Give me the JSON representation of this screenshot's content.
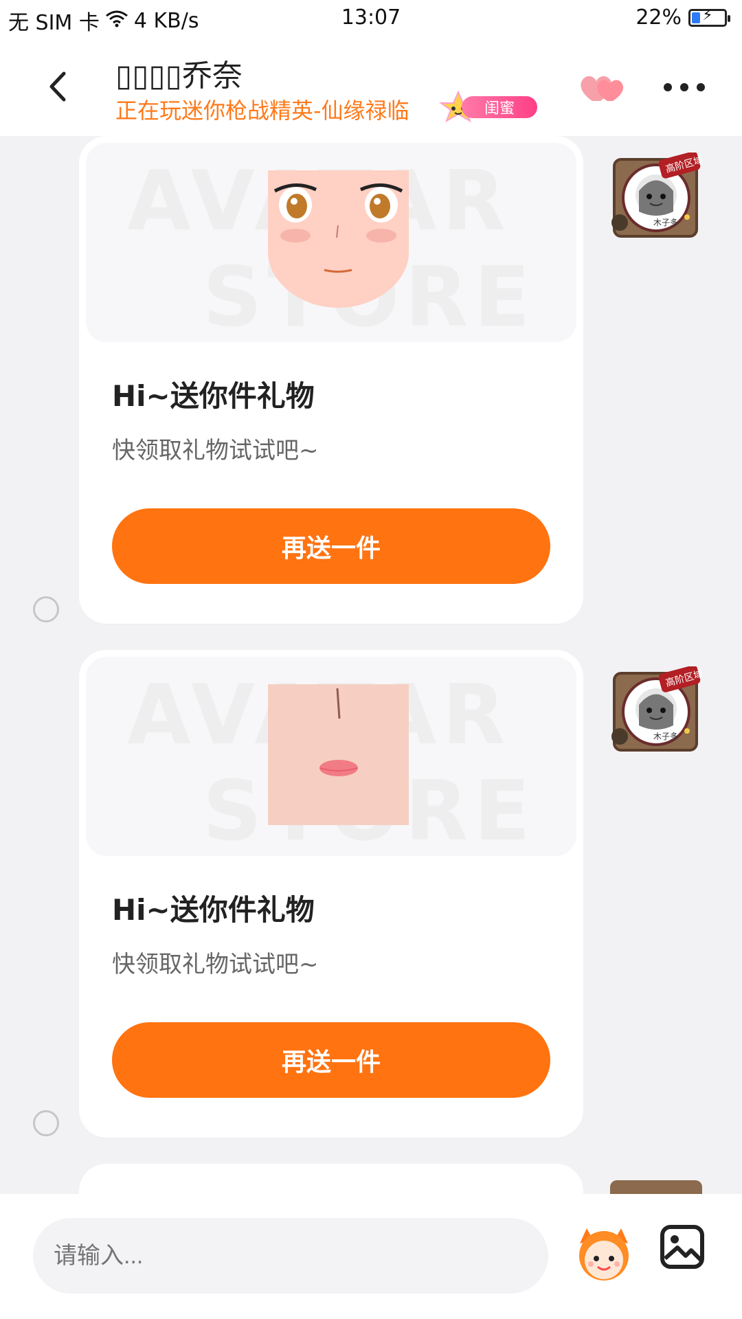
{
  "status_bar": {
    "carrier": "无 SIM 卡",
    "speed": "4 KB/s",
    "time": "13:07",
    "battery": "22%"
  },
  "header": {
    "title": "▯▯▯▯乔奈",
    "subtitle": "正在玩迷你枪战精英-仙缘禄临",
    "badge": "闺蜜"
  },
  "messages": [
    {
      "title": "Hi~送你件礼物",
      "subtitle": "快领取礼物试试吧~",
      "button": "再送一件",
      "watermark_top": "AVATAR",
      "watermark_bottom": "STORE",
      "avatar_badge": "高阶区域",
      "avatar_sig": "木子多"
    },
    {
      "title": "Hi~送你件礼物",
      "subtitle": "快领取礼物试试吧~",
      "button": "再送一件",
      "watermark_top": "AVATAR",
      "watermark_bottom": "STORE",
      "avatar_badge": "高阶区域",
      "avatar_sig": "木子多"
    }
  ],
  "input": {
    "placeholder": "请输入..."
  },
  "colors": {
    "accent": "#ff7310",
    "badge_pink": "#ff3f86"
  },
  "icons": {
    "back": "chevron-left-icon",
    "hearts": "hearts-icon",
    "more": "more-icon",
    "mascot": "mascot-icon",
    "image": "image-icon"
  }
}
